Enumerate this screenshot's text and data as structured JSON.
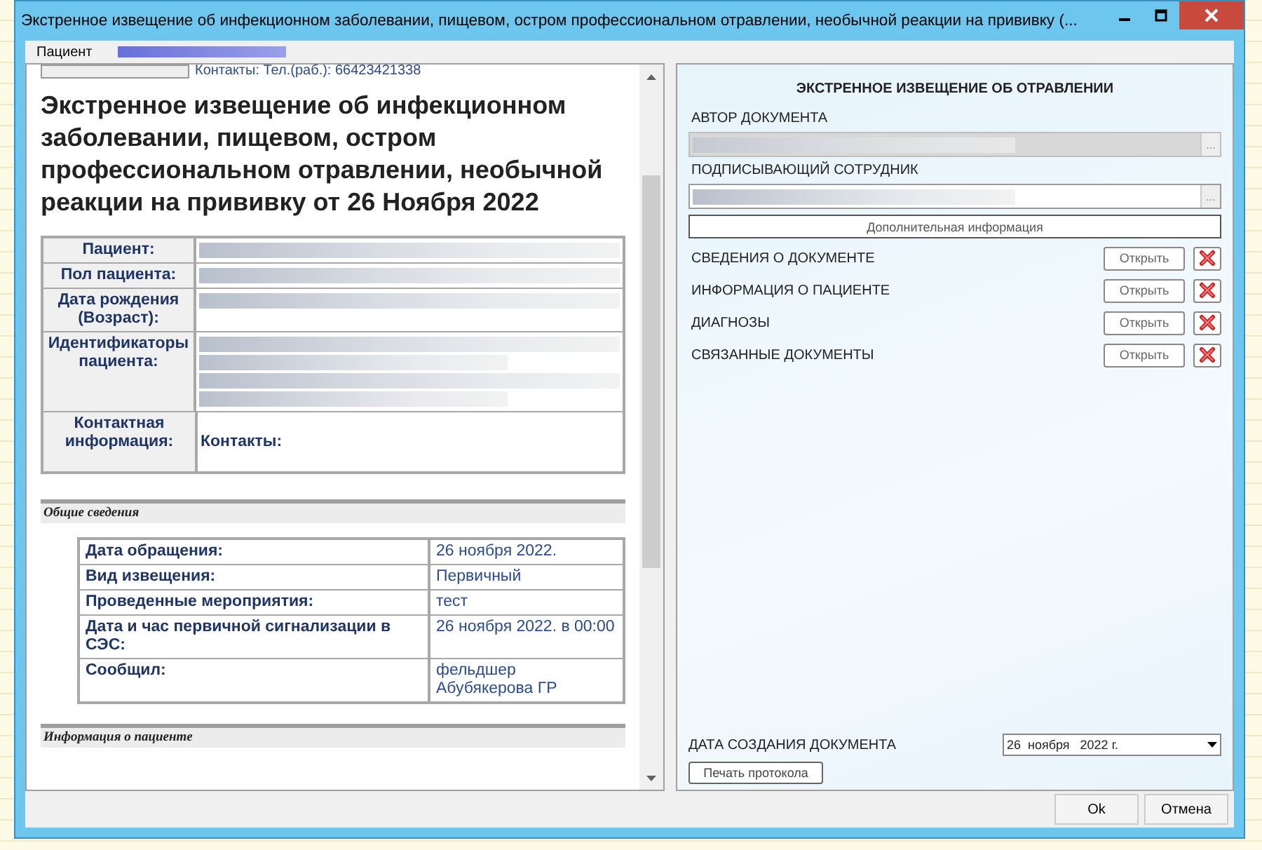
{
  "window": {
    "title": "Экстренное извещение об инфекционном заболевании, пищевом, остром профессиональном отравлении, необычной реакции на прививку  (..."
  },
  "patient_bar": {
    "label": "Пациент"
  },
  "document": {
    "top_row_text": "Контакты: Тел.(раб.): 66423421338",
    "title": "Экстренное извещение об инфекционном заболевании, пищевом, остром профессиональном отравлении, необычной реакции на прививку от 26 Ноября 2022",
    "patient_rows": [
      {
        "label": "Пациент:",
        "kind": "redacted"
      },
      {
        "label": "Пол пациента:",
        "kind": "redacted"
      },
      {
        "label": "Дата рождения (Возраст):",
        "kind": "redacted"
      },
      {
        "label": "Идентификаторы пациента:",
        "kind": "redacted"
      },
      {
        "label": "Контактная информация:",
        "kind": "text",
        "value": "Контакты:"
      }
    ],
    "sections": [
      {
        "heading": "Общие сведения",
        "rows": [
          {
            "label": "Дата обращения:",
            "value": "26 ноября 2022."
          },
          {
            "label": "Вид извещения:",
            "value": "Первичный"
          },
          {
            "label": "Проведенные мероприятия:",
            "value": "тест"
          },
          {
            "label": "Дата и час первичной сигнализации в СЭС:",
            "value": "26 ноября 2022. в 00:00"
          },
          {
            "label": "Сообщил:",
            "value": "фельдшер Абубякерова ГР"
          }
        ]
      },
      {
        "heading": "Информация о пациенте"
      }
    ]
  },
  "form": {
    "heading": "ЭКСТРЕННОЕ ИЗВЕЩЕНИЕ ОБ ОТРАВЛЕНИИ",
    "fields": [
      {
        "label": "АВТОР ДОКУМЕНТА",
        "disabled": true,
        "button": "..."
      },
      {
        "label": "ПОДПИСЫВАЮЩИЙ СОТРУДНИК",
        "disabled": false,
        "button": "..."
      }
    ],
    "extra_button": "Дополнительная информация",
    "items": [
      {
        "label": "СВЕДЕНИЯ О ДОКУМЕНТЕ",
        "button": "Открыть"
      },
      {
        "label": "ИНФОРМАЦИЯ О ПАЦИЕНТЕ",
        "button": "Открыть"
      },
      {
        "label": "ДИАГНОЗЫ",
        "button": "Открыть"
      },
      {
        "label": "СВЯЗАННЫЕ ДОКУМЕНТЫ",
        "button": "Открыть"
      }
    ],
    "date": {
      "label": "ДАТА СОЗДАНИЯ ДОКУМЕНТА",
      "value": "26  ноября   2022 г."
    },
    "print_button": "Печать протокола"
  },
  "footer_buttons": [
    "Ok",
    "Отмена"
  ]
}
